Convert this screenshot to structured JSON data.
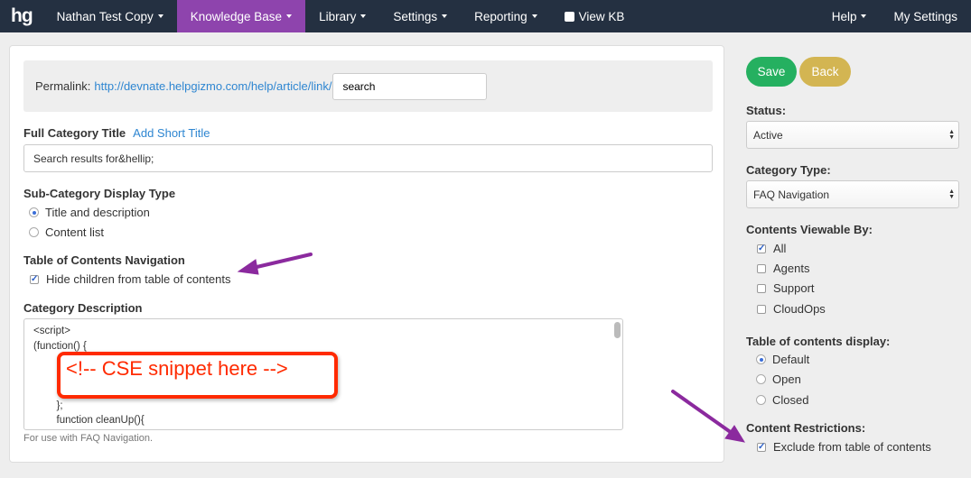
{
  "nav": {
    "logo": "hg",
    "items": [
      {
        "label": "Nathan Test Copy"
      },
      {
        "label": "Knowledge Base"
      },
      {
        "label": "Library"
      },
      {
        "label": "Settings"
      },
      {
        "label": "Reporting"
      },
      {
        "label": "View KB"
      }
    ],
    "right": [
      {
        "label": "Help"
      },
      {
        "label": "My Settings"
      }
    ],
    "active_color": "#8e44ad"
  },
  "permalink": {
    "label": "Permalink:",
    "url": "http://devnate.helpgizmo.com/help/article/link/",
    "value": "search"
  },
  "title": {
    "label": "Full Category Title",
    "add_short": "Add Short Title",
    "value": "Search results for&hellip;"
  },
  "subcat": {
    "label": "Sub-Category Display Type",
    "options": [
      "Title and description",
      "Content list"
    ],
    "selected": 0
  },
  "toc": {
    "label": "Table of Contents Navigation",
    "option": "Hide children from table of contents",
    "checked": true
  },
  "desc": {
    "label": "Category Description",
    "lines": [
      "<script>",
      "(function() {",
      "",
      "",
      "",
      "        };",
      "        function cleanUp(){"
    ],
    "hint": "For use with FAQ Navigation."
  },
  "callout": "<!-- CSE snippet here -->",
  "side": {
    "save": "Save",
    "back": "Back",
    "status_label": "Status:",
    "status": "Active",
    "type_label": "Category Type:",
    "type": "FAQ Navigation",
    "viewable_label": "Contents Viewable By:",
    "viewable": [
      {
        "label": "All",
        "checked": true
      },
      {
        "label": "Agents",
        "checked": false
      },
      {
        "label": "Support",
        "checked": false
      },
      {
        "label": "CloudOps",
        "checked": false
      }
    ],
    "tocd_label": "Table of contents display:",
    "tocd": [
      "Default",
      "Open",
      "Closed"
    ],
    "tocd_selected": 0,
    "restr_label": "Content Restrictions:",
    "restr": "Exclude from table of contents",
    "restr_checked": true
  },
  "colors": {
    "save": "#25b060",
    "back": "#d3b552",
    "nav": "#243041",
    "link": "#2e86d1",
    "annotation": "#ff2a00",
    "arrow": "#8b2a9e"
  }
}
